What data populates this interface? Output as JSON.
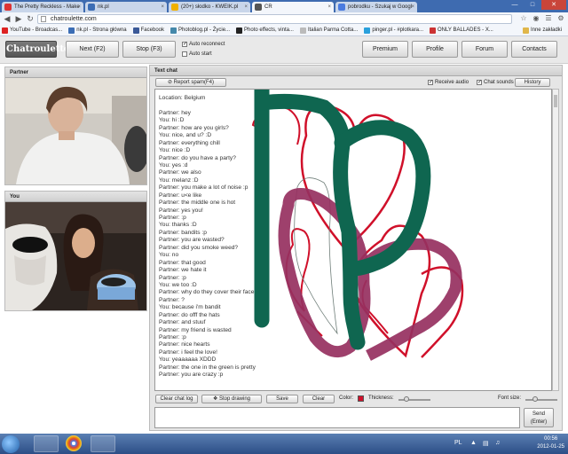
{
  "browser": {
    "tabs": [
      {
        "title": "The Pretty Reckless - Make",
        "fav": "#d33",
        "active": false
      },
      {
        "title": "nk.pl",
        "fav": "#3b6db5",
        "active": false
      },
      {
        "title": "(20+) słodko - KWEIK.pl",
        "fav": "#f0b000",
        "active": false
      },
      {
        "title": "CR",
        "fav": "#555",
        "active": true
      },
      {
        "title": "pobrodku - Szukaj w Googl",
        "fav": "#4a7be0",
        "active": false
      }
    ],
    "url": "chatroulette.com",
    "bookmarks": [
      {
        "label": "YouTube - Broadcas...",
        "color": "#d22"
      },
      {
        "label": "nk.pl - Strona główna",
        "color": "#3b6db5"
      },
      {
        "label": "Facebook",
        "color": "#3b5998"
      },
      {
        "label": "Photoblog.pl - Życie...",
        "color": "#48a"
      },
      {
        "label": "Photo effects, vinta...",
        "color": "#222"
      },
      {
        "label": "Italian Parma Cotta...",
        "color": "#bbb"
      },
      {
        "label": "pinger.pl - #plotkara...",
        "color": "#29a0dc"
      },
      {
        "label": "ONLY BALLADES - X...",
        "color": "#c33"
      }
    ],
    "other_bookmarks": "Inne zakładki"
  },
  "app": {
    "logo": "Chatroulette",
    "next_button": "Next (F2)",
    "stop_button": "Stop (F3)",
    "auto_reconnect": "Auto reconnect",
    "auto_start": "Auto start",
    "premium": "Premium",
    "profile": "Profile",
    "forum": "Forum",
    "contacts": "Contacts"
  },
  "partner_panel": {
    "title": "Partner"
  },
  "you_panel": {
    "title": "You"
  },
  "chat": {
    "title": "Text chat",
    "report_spam": "Report spam(F4)",
    "receive_audio": "Receive audio",
    "chat_sounds": "Chat sounds",
    "history": "History",
    "lines": [
      "Location: Belgium",
      "",
      "Partner: hey",
      "You: hi :D",
      "Partner: how are you girls?",
      "You: nice, and u? :D",
      "Partner: everything chill",
      "You: nice :D",
      "Partner: do you have a party?",
      "You: yes :d",
      "Partner: we also",
      "You: melanz :D",
      "Partner: you make a lot of noise :p",
      "Partner: u<e like",
      "Partner: the middle one is hot",
      "Partner: yes you!",
      "Partner: :p",
      "You: thanks :D",
      "Partner: bandits :p",
      "Partner: you are wasted?",
      "Partner: did you smoke weed?",
      "You: no",
      "Partner: that good",
      "Partner: we hate it",
      "Partner: :p",
      "You: we too :D",
      "Partner: why do they cover their face",
      "Partner: ?",
      "You: because i'm bandit",
      "Partner: do offf the hats",
      "Partner: and stuuf",
      "Partner: my friend is wasted",
      "Partner: :p",
      "Partner: nice hearts",
      "Partner: i feel the love!",
      "You: yeaaaaaa XDDD",
      "Partner: the one in the green is pretty",
      "Partner: you are crazy :p"
    ],
    "clear_chat_log": "Clear chat log",
    "stop_drawing": "Stop drawing",
    "save": "Save",
    "clear": "Clear",
    "color_label": "Color:",
    "thickness_label": "Thickness:",
    "font_size_label": "Font size:",
    "send_line1": "Send",
    "send_line2": "(Enter)",
    "drawing_colors": {
      "red": "#d0102a",
      "green": "#0f6650",
      "purple": "#963060"
    }
  },
  "taskbar": {
    "language": "PL",
    "time": "00:56",
    "date": "2012-01-25"
  }
}
